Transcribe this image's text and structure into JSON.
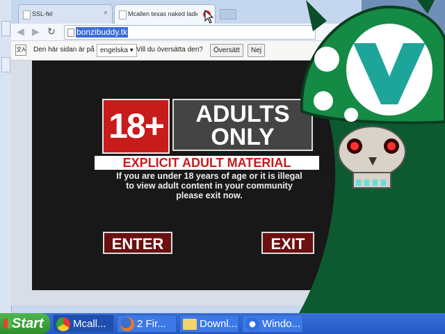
{
  "browser": {
    "tabs": [
      {
        "label": "SSL-fel"
      },
      {
        "label": "Mcallen texas naked ladies p"
      }
    ],
    "url": "bonzibuddy.tk",
    "translate_bar": {
      "text_before": "Den här sidan är på",
      "language": "engelska",
      "question": "Vill du översätta den?",
      "translate_button": "Översätt",
      "no_button": "Nej"
    }
  },
  "content": {
    "badge_18": "18+",
    "adults_line1": "ADULTS",
    "adults_line2": "ONLY",
    "explicit": "EXPLICIT ADULT MATERIAL",
    "warning_line1": "If you are under 18 years of age or it is illegal",
    "warning_line2": "to view adult content in your community",
    "warning_line3": "please exit now.",
    "enter_label": "ENTER",
    "exit_label": "EXIT"
  },
  "taskbar": {
    "start_label": "Start",
    "items": [
      {
        "label": "Mcall...",
        "icon": "chrome-icon"
      },
      {
        "label": "2 Fir...",
        "icon": "firefox-icon"
      },
      {
        "label": "Downl...",
        "icon": "folder-icon"
      },
      {
        "label": "Windo...",
        "icon": "windows-media-icon"
      }
    ]
  },
  "colors": {
    "badge_red": "#c81b1b",
    "logo_green": "#0d5a30",
    "taskbar_blue": "#2458c8"
  }
}
